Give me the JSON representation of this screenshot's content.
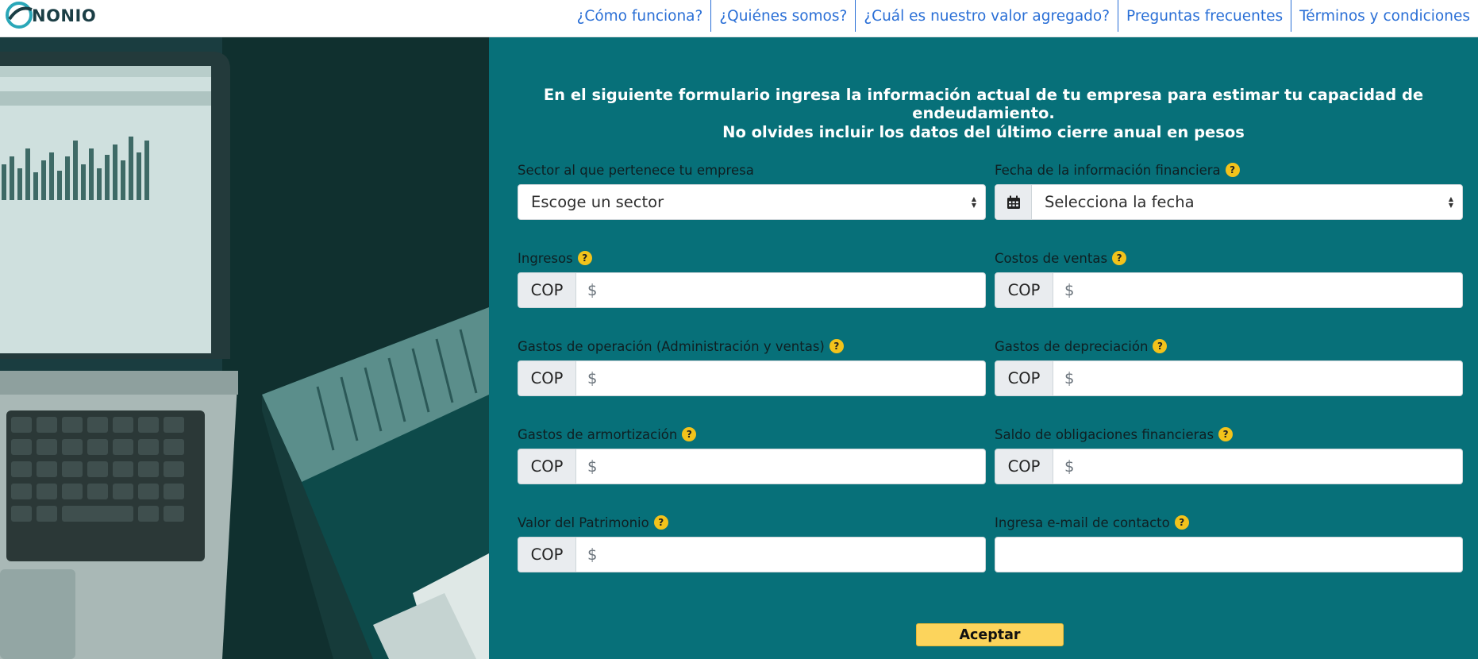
{
  "brand": {
    "name": "NONIO"
  },
  "nav": [
    {
      "label": "¿Cómo funciona?"
    },
    {
      "label": "¿Quiénes somos?"
    },
    {
      "label": "¿Cuál es nuestro valor agregado?"
    },
    {
      "label": "Preguntas frecuentes"
    },
    {
      "label": "Términos y condiciones"
    }
  ],
  "form": {
    "intro_line1": "En el siguiente formulario ingresa la información actual de tu empresa para estimar tu capacidad de endeudamiento.",
    "intro_line2": "No olvides incluir los datos del último cierre anual en pesos",
    "sector": {
      "label": "Sector al que pertenece tu empresa",
      "value": "Escoge un sector"
    },
    "date": {
      "label": "Fecha de la información financiera",
      "value": "Selecciona la fecha"
    },
    "currency": "COP",
    "money_placeholder": "$",
    "help_glyph": "?",
    "ingresos": {
      "label": "Ingresos"
    },
    "costos_ventas": {
      "label": "Costos de ventas"
    },
    "gastos_operacion": {
      "label": "Gastos de operación (Administración y ventas)"
    },
    "gastos_depreciacion": {
      "label": "Gastos de depreciación"
    },
    "gastos_amortizacion": {
      "label": "Gastos de armortización"
    },
    "saldo_obligaciones": {
      "label": "Saldo de obligaciones financieras"
    },
    "patrimonio": {
      "label": "Valor del Patrimonio"
    },
    "email": {
      "label": "Ingresa e-mail de contacto",
      "value": ""
    },
    "submit_label": "Aceptar"
  },
  "colors": {
    "panel_teal": "#077079",
    "nav_link": "#2a6fd6",
    "help_badge": "#f3c31b",
    "accept_button": "#fcd45c"
  },
  "icons": [
    "logo-mark-icon",
    "calendar-icon",
    "sort-caret-icon",
    "help-icon"
  ]
}
